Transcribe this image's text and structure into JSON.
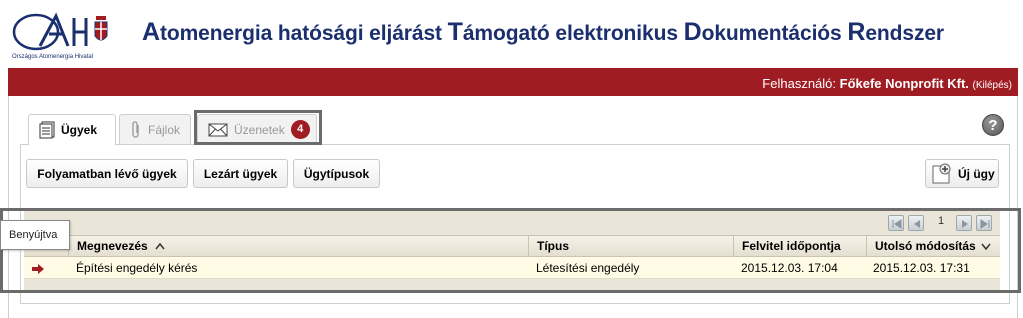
{
  "header": {
    "logo_caption": "Országos Atomenergia Hivatal",
    "title_parts": [
      {
        "cap": "A",
        "rest": "tomenergia hatósági eljárást "
      },
      {
        "cap": "T",
        "rest": "ámogató elektronikus "
      },
      {
        "cap": "D",
        "rest": "okumentációs "
      },
      {
        "cap": "R",
        "rest": "endszer"
      }
    ]
  },
  "userbar": {
    "label": "Felhasználó:",
    "user_name": "Főkefe Nonprofit Kft.",
    "logout": "(Kilépés)",
    "bg_color": "#a01c23"
  },
  "tabs": [
    {
      "label": "Ügyek",
      "icon": "document-icon",
      "active": true
    },
    {
      "label": "Fájlok",
      "icon": "paperclip-icon",
      "active": false
    },
    {
      "label": "Üzenetek",
      "icon": "envelope-icon",
      "active": false,
      "badge": "4"
    }
  ],
  "toolbar": {
    "in_progress": "Folyamatban lévő ügyek",
    "closed": "Lezárt ügyek",
    "case_types": "Ügytípusok",
    "new_case": "Új ügy"
  },
  "pager": {
    "page": "1"
  },
  "grid": {
    "columns": [
      "Megnevezés",
      "Típus",
      "Felvitel időpontja",
      "Utolsó módosítás"
    ],
    "rows": [
      {
        "name": "Építési engedély kérés",
        "type": "Létesítési engedély",
        "created": "2015.12.03. 17:04",
        "modified": "2015.12.03. 17:31"
      }
    ]
  },
  "tooltip": "Benyújtva"
}
